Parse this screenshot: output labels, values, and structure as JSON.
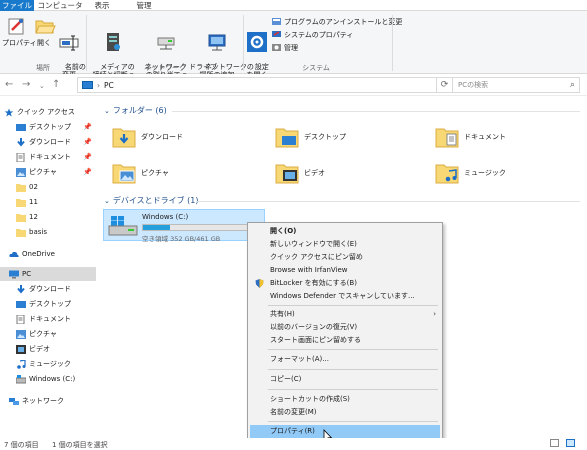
{
  "tabs": [
    "ファイル",
    "コンピューター",
    "表示",
    "管理"
  ],
  "ribbon": {
    "location": {
      "label": "場所",
      "buttons": [
        "プロパティ",
        "開く",
        "名前の\n変更"
      ]
    },
    "network": {
      "label": "ネットワーク",
      "buttons": [
        "メディアの\n接続と切断 ▾",
        "ネットワーク ドライブ\nの割り当て ▾",
        "ネットワークの\n場所の追加"
      ]
    },
    "system": {
      "label": "システム",
      "settings_button": "設定\nを開く",
      "items": [
        "プログラムのアンインストールと変更",
        "システムのプロパティ",
        "管理"
      ]
    }
  },
  "address": {
    "path": "PC",
    "search_placeholder": "PCの検索"
  },
  "nav": {
    "quick_access": "クイック アクセス",
    "quick_items": [
      {
        "label": "デスクトップ",
        "icon": "desktop-icon"
      },
      {
        "label": "ダウンロード",
        "icon": "download-icon"
      },
      {
        "label": "ドキュメント",
        "icon": "documents-icon"
      },
      {
        "label": "ピクチャ",
        "icon": "pictures-icon"
      },
      {
        "label": "02",
        "icon": "folder-icon"
      },
      {
        "label": "11",
        "icon": "folder-icon"
      },
      {
        "label": "12",
        "icon": "folder-icon"
      },
      {
        "label": "basis",
        "icon": "folder-icon"
      }
    ],
    "onedrive": "OneDrive",
    "pc": "PC",
    "pc_items": [
      "ダウンロード",
      "デスクトップ",
      "ドキュメント",
      "ピクチャ",
      "ビデオ",
      "ミュージック",
      "Windows (C:)"
    ],
    "network": "ネットワーク"
  },
  "content": {
    "folders_header": "フォルダー (6)",
    "folders": [
      "ダウンロード",
      "デスクトップ",
      "ドキュメント",
      "ピクチャ",
      "ビデオ",
      "ミュージック"
    ],
    "drives_header": "デバイスとドライブ (1)",
    "drive": {
      "name": "Windows (C:)",
      "free": "空き領域 352 GB/461 GB",
      "used_fraction": 0.24
    }
  },
  "context_menu": {
    "items": [
      "開く(O)",
      "新しいウィンドウで開く(E)",
      "クイック アクセスにピン留め",
      "Browse with IrfanView",
      "BitLocker を有効にする(B)",
      "Windows Defender でスキャンしています...",
      "共有(H)",
      "以前のバージョンの復元(V)",
      "スタート画面にピン留めする",
      "フォーマット(A)...",
      "コピー(C)",
      "ショートカットの作成(S)",
      "名前の変更(M)",
      "プロパティ(R)"
    ]
  },
  "status": {
    "items_count": "7 個の項目",
    "selected": "1 個の項目を選択"
  },
  "colors": {
    "accent": "#1979ca",
    "selection": "#cce8ff",
    "menu_highlight": "#91c9f7",
    "folder": "#f8d775"
  }
}
